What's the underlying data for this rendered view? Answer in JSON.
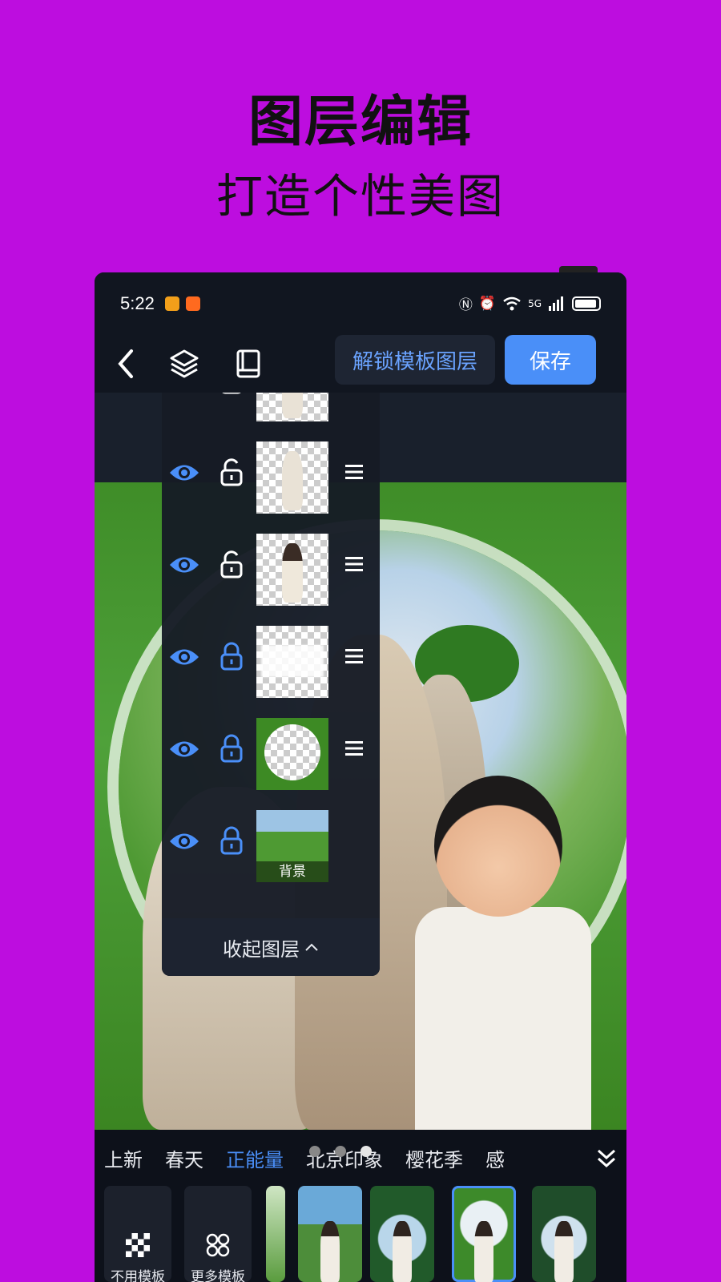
{
  "promo": {
    "headline": "图层编辑",
    "subline": "打造个性美图"
  },
  "status_bar": {
    "time": "5:22",
    "network": "5G"
  },
  "toolbar": {
    "unlock_label": "解锁模板图层",
    "save_label": "保存"
  },
  "layer_panel": {
    "background_label": "背景",
    "collapse_label": "收起图层",
    "layers": [
      {
        "visible": true,
        "locked": false,
        "kind": "figure"
      },
      {
        "visible": true,
        "locked": false,
        "kind": "figure"
      },
      {
        "visible": true,
        "locked": false,
        "kind": "figure-dark-hair"
      },
      {
        "visible": true,
        "locked": true,
        "kind": "text"
      },
      {
        "visible": true,
        "locked": true,
        "kind": "frame"
      },
      {
        "visible": true,
        "locked": true,
        "kind": "background"
      }
    ]
  },
  "categories": {
    "tabs": [
      "上新",
      "春天",
      "正能量",
      "北京印象",
      "樱花季",
      "感"
    ],
    "active_index": 2
  },
  "template_tools": {
    "no_template": "不用模板",
    "more_templates": "更多模板"
  },
  "colors": {
    "accent": "#4a8ff8",
    "promo_background": "#bd0ddf"
  }
}
